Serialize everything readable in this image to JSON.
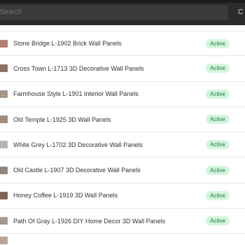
{
  "search": {
    "placeholder": "Search",
    "action_label": "C"
  },
  "products": [
    {
      "name": "Stone Bridge L-1902 Brick Wall Panels",
      "status": "Active",
      "thumb_color": "#b07a68"
    },
    {
      "name": "Cross Town L-1713 3D Decorative Wall Panels",
      "status": "Active",
      "thumb_color": "#8a6a5c"
    },
    {
      "name": "Farmhouse Style L-1901 Interior Wall Panels",
      "status": "Active",
      "thumb_color": "#a89583"
    },
    {
      "name": "Old Temple L-1925 3D Wall Panels",
      "status": "Active",
      "thumb_color": "#9b8a76"
    },
    {
      "name": "White Grey L-1702 3D Decorative Wall Panels",
      "status": "Active",
      "thumb_color": "#b8b8b0"
    },
    {
      "name": "Old Castle L-1907 3D Decorative Wall Panels",
      "status": "Active",
      "thumb_color": "#8c8477"
    },
    {
      "name": "Honey Coffee L-1919 3D Wall Panels",
      "status": "Active",
      "thumb_color": "#7d5a4a"
    },
    {
      "name": "Path Of Gray L-1926 DIY Home Decor 3D Wall Panels",
      "status": "Active",
      "thumb_color": "#a19a92"
    }
  ]
}
